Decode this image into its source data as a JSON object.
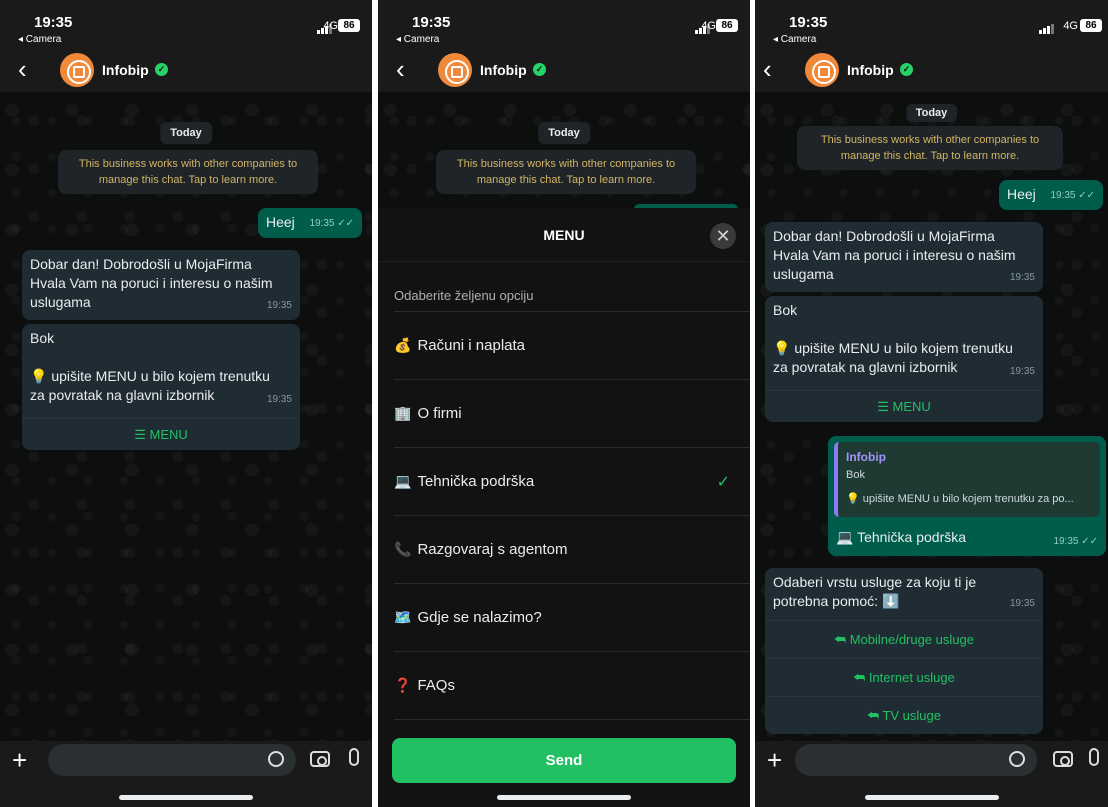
{
  "status": {
    "time": "19:35",
    "back_app": "◂ Camera",
    "network": "4G",
    "battery": "86"
  },
  "chat": {
    "contact_name": "Infobip",
    "verified_icon": "verified-check-icon",
    "date_label": "Today",
    "business_notice": "This business works with other companies to manage this chat. Tap to learn more."
  },
  "messages": {
    "heej": {
      "text": "Heej",
      "time": "19:35 ✓✓"
    },
    "welcome": {
      "text": "Dobar dan! Dobrodošli u MojaFirma Hvala Vam na poruci i interesu o našim uslugama",
      "time": "19:35"
    },
    "bok_title": "Bok",
    "bok_hint": "💡 upišite MENU u bilo kojem trenutku za povratak na glavni izbornik",
    "bok_time": "19:35",
    "menu_button": "☰ MENU",
    "reply_quote_author": "Infobip",
    "reply_quote_text1": "Bok",
    "reply_quote_text2": "💡 upišite MENU u bilo kojem trenutku za po...",
    "reply_text": "💻 Tehnička podrška",
    "reply_time": "19:35 ✓✓",
    "choose_text": "Odaberi vrstu usluge za koju ti je potrebna pomoć: ⬇️",
    "choose_time": "19:35",
    "quick_replies": [
      "Mobilne/druge usluge",
      "Internet usluge",
      "TV usluge"
    ]
  },
  "menu_sheet": {
    "title": "MENU",
    "subtitle": "Odaberite željenu opciju",
    "options": [
      {
        "emoji": "💰",
        "label": "Računi i naplata"
      },
      {
        "emoji": "🏢",
        "label": "O firmi"
      },
      {
        "emoji": "💻",
        "label": "Tehnička podrška",
        "selected": true
      },
      {
        "emoji": "📞",
        "label": "Razgovaraj s agentom"
      },
      {
        "emoji": "🗺️",
        "label": "Gdje se nalazimo?"
      },
      {
        "emoji": "❓",
        "label": "FAQs"
      }
    ],
    "send_label": "Send",
    "close_glyph": "✕",
    "check_glyph": "✓"
  },
  "composer": {
    "plus_glyph": "+",
    "icons": [
      "sticker-icon",
      "camera-icon",
      "mic-icon"
    ]
  },
  "colors": {
    "accent": "#21c063",
    "outgoing_bubble": "#005c4b",
    "incoming_bubble": "#202c33",
    "notice_text": "#d4b464"
  }
}
